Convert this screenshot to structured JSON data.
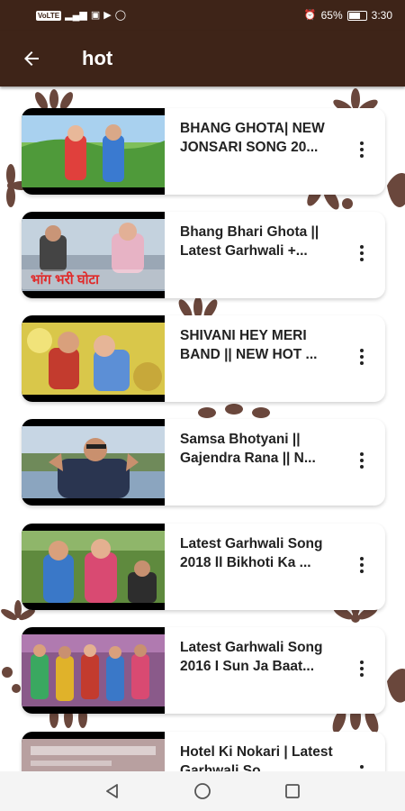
{
  "status_bar": {
    "left_badge": "VoLTE",
    "right_text": "65%",
    "time": "3:30"
  },
  "app_bar": {
    "title": "hot",
    "back_icon": "arrow-back-icon"
  },
  "colors": {
    "primary": "#3e2418",
    "accent_decor": "#5a3326"
  },
  "videos": [
    {
      "title": "BHANG GHOTA| NEW JONSARI SONG 20...",
      "thumb": "green-field-couple"
    },
    {
      "title": "Bhang Bhari Ghota || Latest Garhwali +...",
      "thumb": "hindi-title-poster"
    },
    {
      "title": "SHIVANI HEY MERI BAND || NEW HOT ...",
      "thumb": "flowers-couple"
    },
    {
      "title": "Samsa Bhotyani || Gajendra Rana || N...",
      "thumb": "singer-pointing"
    },
    {
      "title": "Latest Garhwali Song 2018 ll Bikhoti Ka ...",
      "thumb": "couple-poster"
    },
    {
      "title": "Latest Garhwali Song 2016 I Sun Ja Baat...",
      "thumb": "group-dance"
    },
    {
      "title": "Hotel Ki Nokari | Latest Garhwali So...",
      "thumb": "poster-text"
    }
  ],
  "nav_bar": {
    "back": "nav-back-icon",
    "home": "nav-home-icon",
    "recents": "nav-recents-icon"
  }
}
